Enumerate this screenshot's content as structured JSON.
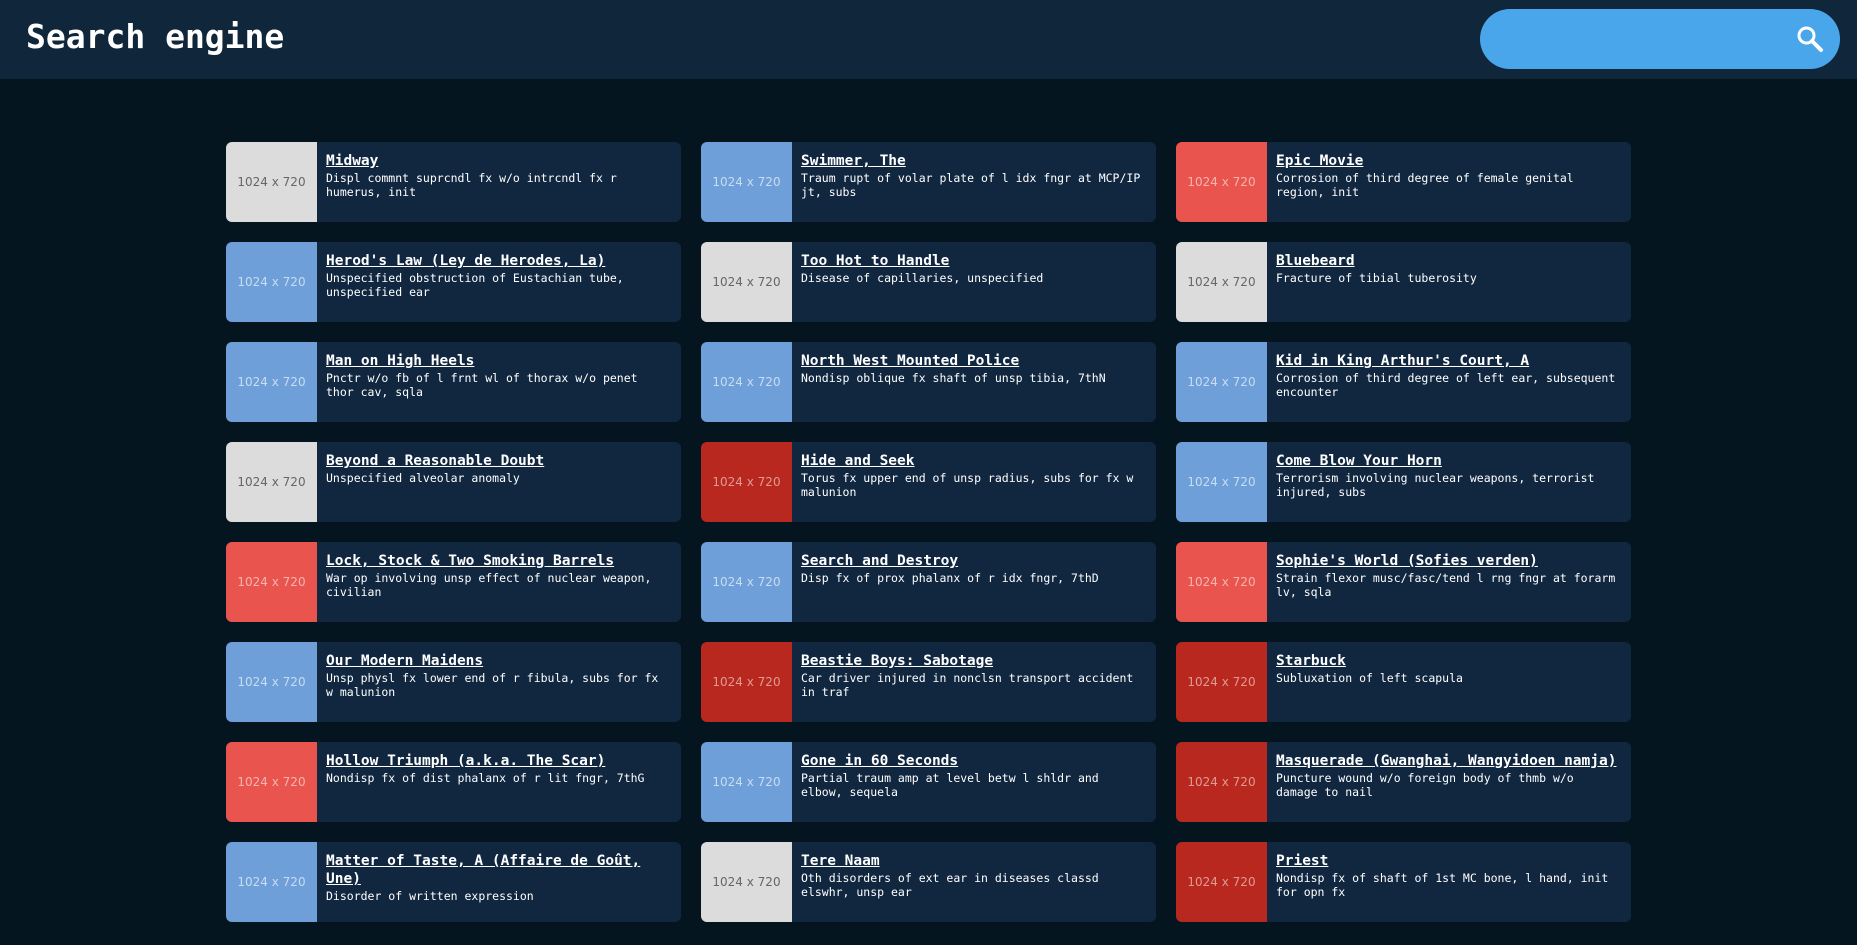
{
  "header": {
    "title": "Search engine",
    "search_placeholder": "",
    "search_value": "",
    "search_icon": "search-icon"
  },
  "colors": {
    "header_bg": "#10263b",
    "page_bg": "#051520",
    "card_bg": "#112740",
    "search_bg": "#4aa6ea",
    "thumb_gray": "#dcdcdc",
    "thumb_blue": "#6f9fd8",
    "thumb_red": "#ea544e",
    "thumb_darkred": "#b8281e"
  },
  "results": [
    {
      "title": "Midway",
      "description": "Displ commnt suprcndl fx w/o intrcndl fx r humerus, init",
      "thumb_label": "1024 x 720",
      "thumb_color": "#dcdcdc",
      "thumb_text_color": "#666666"
    },
    {
      "title": "Swimmer, The",
      "description": "Traum rupt of volar plate of l idx fngr at MCP/IP jt, subs",
      "thumb_label": "1024 x 720",
      "thumb_color": "#6f9fd8",
      "thumb_text_color": "#c8dcf2"
    },
    {
      "title": "Epic Movie",
      "description": "Corrosion of third degree of female genital region, init",
      "thumb_label": "1024 x 720",
      "thumb_color": "#ea544e",
      "thumb_text_color": "#f6b4b0"
    },
    {
      "title": "Herod's Law (Ley de Herodes, La)",
      "description": "Unspecified obstruction of Eustachian tube, unspecified ear",
      "thumb_label": "1024 x 720",
      "thumb_color": "#6f9fd8",
      "thumb_text_color": "#c8dcf2"
    },
    {
      "title": "Too Hot to Handle",
      "description": "Disease of capillaries, unspecified",
      "thumb_label": "1024 x 720",
      "thumb_color": "#dcdcdc",
      "thumb_text_color": "#666666"
    },
    {
      "title": "Bluebeard",
      "description": "Fracture of tibial tuberosity",
      "thumb_label": "1024 x 720",
      "thumb_color": "#dcdcdc",
      "thumb_text_color": "#666666"
    },
    {
      "title": "Man on High Heels",
      "description": "Pnctr w/o fb of l frnt wl of thorax w/o penet thor cav, sqla",
      "thumb_label": "1024 x 720",
      "thumb_color": "#6f9fd8",
      "thumb_text_color": "#c8dcf2"
    },
    {
      "title": "North West Mounted Police",
      "description": "Nondisp oblique fx shaft of unsp tibia, 7thN",
      "thumb_label": "1024 x 720",
      "thumb_color": "#6f9fd8",
      "thumb_text_color": "#c8dcf2"
    },
    {
      "title": "Kid in King Arthur's Court, A",
      "description": "Corrosion of third degree of left ear, subsequent encounter",
      "thumb_label": "1024 x 720",
      "thumb_color": "#6f9fd8",
      "thumb_text_color": "#c8dcf2"
    },
    {
      "title": "Beyond a Reasonable Doubt",
      "description": "Unspecified alveolar anomaly",
      "thumb_label": "1024 x 720",
      "thumb_color": "#dcdcdc",
      "thumb_text_color": "#666666"
    },
    {
      "title": "Hide and Seek",
      "description": "Torus fx upper end of unsp radius, subs for fx w malunion",
      "thumb_label": "1024 x 720",
      "thumb_color": "#b8281e",
      "thumb_text_color": "#e09a94"
    },
    {
      "title": "Come Blow Your Horn",
      "description": "Terrorism involving nuclear weapons, terrorist injured, subs",
      "thumb_label": "1024 x 720",
      "thumb_color": "#6f9fd8",
      "thumb_text_color": "#c8dcf2"
    },
    {
      "title": "Lock, Stock & Two Smoking Barrels",
      "description": "War op involving unsp effect of nuclear weapon, civilian",
      "thumb_label": "1024 x 720",
      "thumb_color": "#ea544e",
      "thumb_text_color": "#f6b4b0"
    },
    {
      "title": "Search and Destroy",
      "description": "Disp fx of prox phalanx of r idx fngr, 7thD",
      "thumb_label": "1024 x 720",
      "thumb_color": "#6f9fd8",
      "thumb_text_color": "#c8dcf2"
    },
    {
      "title": "Sophie's World (Sofies verden)",
      "description": "Strain flexor musc/fasc/tend l rng fngr at forarm lv, sqla",
      "thumb_label": "1024 x 720",
      "thumb_color": "#ea544e",
      "thumb_text_color": "#f6b4b0"
    },
    {
      "title": "Our Modern Maidens",
      "description": "Unsp physl fx lower end of r fibula, subs for fx w malunion",
      "thumb_label": "1024 x 720",
      "thumb_color": "#6f9fd8",
      "thumb_text_color": "#c8dcf2"
    },
    {
      "title": "Beastie Boys: Sabotage",
      "description": "Car driver injured in nonclsn transport accident in traf",
      "thumb_label": "1024 x 720",
      "thumb_color": "#b8281e",
      "thumb_text_color": "#e09a94"
    },
    {
      "title": "Starbuck",
      "description": "Subluxation of left scapula",
      "thumb_label": "1024 x 720",
      "thumb_color": "#b8281e",
      "thumb_text_color": "#e09a94"
    },
    {
      "title": "Hollow Triumph (a.k.a. The Scar)",
      "description": "Nondisp fx of dist phalanx of r lit fngr, 7thG",
      "thumb_label": "1024 x 720",
      "thumb_color": "#ea544e",
      "thumb_text_color": "#f6b4b0"
    },
    {
      "title": "Gone in 60 Seconds",
      "description": "Partial traum amp at level betw l shldr and elbow, sequela",
      "thumb_label": "1024 x 720",
      "thumb_color": "#6f9fd8",
      "thumb_text_color": "#c8dcf2"
    },
    {
      "title": "Masquerade (Gwanghai, Wangyidoen namja)",
      "description": "Puncture wound w/o foreign body of thmb w/o damage to nail",
      "thumb_label": "1024 x 720",
      "thumb_color": "#b8281e",
      "thumb_text_color": "#e09a94"
    },
    {
      "title": "Matter of Taste, A (Affaire de Goût, Une)",
      "description": "Disorder of written expression",
      "thumb_label": "1024 x 720",
      "thumb_color": "#6f9fd8",
      "thumb_text_color": "#c8dcf2"
    },
    {
      "title": "Tere Naam",
      "description": "Oth disorders of ext ear in diseases classd elswhr, unsp ear",
      "thumb_label": "1024 x 720",
      "thumb_color": "#dcdcdc",
      "thumb_text_color": "#666666"
    },
    {
      "title": "Priest",
      "description": "Nondisp fx of shaft of 1st MC bone, l hand, init for opn fx",
      "thumb_label": "1024 x 720",
      "thumb_color": "#b8281e",
      "thumb_text_color": "#e09a94"
    }
  ]
}
